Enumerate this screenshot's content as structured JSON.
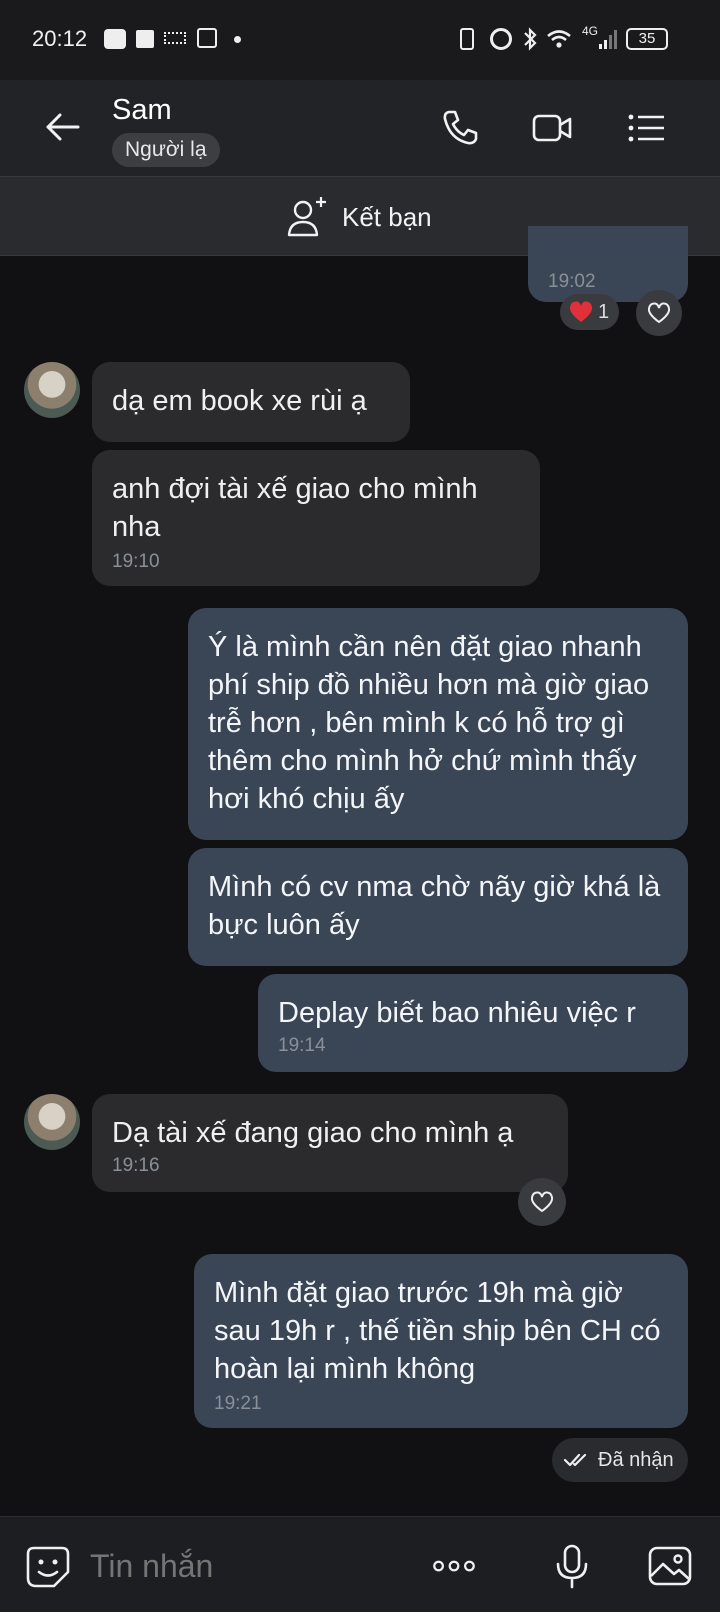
{
  "status_bar": {
    "time": "20:12",
    "app_icons": [
      "zalo-icon",
      "facebook-icon",
      "tiktok-icon",
      "shop-icon"
    ],
    "network": "4G",
    "battery": "35"
  },
  "header": {
    "title": "Sam",
    "subtitle": "Người lạ"
  },
  "add_friend": {
    "label": "Kết bạn"
  },
  "messages": {
    "m0": {
      "time": "19:02",
      "reaction_count": "1"
    },
    "m1": {
      "text": "dạ em book xe rùi ạ"
    },
    "m2": {
      "text": "anh đợi tài xế giao cho mình nha",
      "time": "19:10"
    },
    "m3": {
      "text": "Ý là mình cần nên đặt giao nhanh phí ship đồ nhiều hơn mà giờ giao trễ hơn , bên mình k có hỗ trợ gì thêm cho mình hở chứ mình thấy hơi khó chịu ấy"
    },
    "m4": {
      "text": "Mình có cv nma chờ nãy giờ khá là bực luôn ấy"
    },
    "m5": {
      "text": "Deplay biết bao nhiêu việc r",
      "time": "19:14"
    },
    "m6": {
      "text": "Dạ tài xế đang giao cho mình ạ",
      "time": "19:16"
    },
    "m7": {
      "text": "Mình đặt giao trước 19h mà giờ sau 19h r , thế tiền ship bên CH có hoàn lại mình không",
      "time": "19:21"
    }
  },
  "delivery_status": "Đã nhận",
  "composer": {
    "placeholder": "Tin nhắn"
  },
  "colors": {
    "background": "#111113",
    "incoming_bubble": "#2b2b2e",
    "outgoing_bubble": "#3a4556",
    "reaction_heart": "#e0303a"
  }
}
